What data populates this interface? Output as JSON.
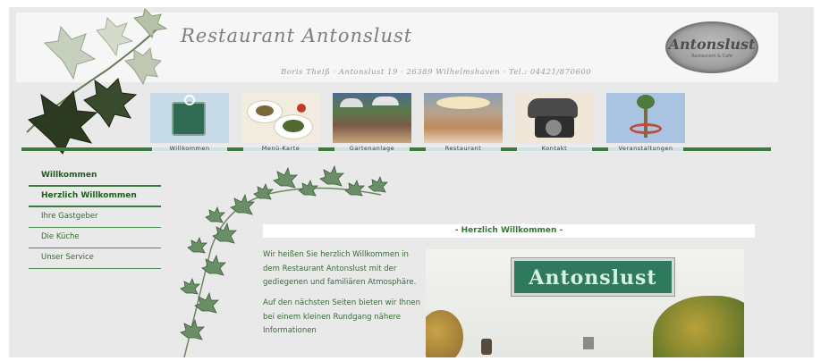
{
  "header": {
    "title": "Restaurant Antonslust",
    "address": "Boris Theiß · Antonslust 19 · 26389 Wilhelmshaven · Tel.: 04421/870600",
    "logo_text": "Antonslust",
    "logo_sub": "Restaurant & Café"
  },
  "nav": {
    "items": [
      {
        "label": "Willkommen"
      },
      {
        "label": "Menü-Karte"
      },
      {
        "label": "Gartenanlage"
      },
      {
        "label": "Restaurant"
      },
      {
        "label": "Kontakt"
      },
      {
        "label": "Veranstaltungen"
      }
    ],
    "accent": "#3c7a3c"
  },
  "sidebar": {
    "items": [
      {
        "label": "Willkommen"
      },
      {
        "label": "Herzlich Willkommen"
      },
      {
        "label": "Ihre Gastgeber"
      },
      {
        "label": "Die Küche"
      },
      {
        "label": "Unser Service"
      }
    ]
  },
  "content": {
    "title": "- Herzlich Willkommen -",
    "para1": "Wir heißen Sie herzlich Willkommen in dem Restaurant Antonslust mit der gediegenen und familiären Atmosphäre.",
    "para2": "Auf den nächsten Seiten bieten wir Ihnen bei einem kleinen Rundgang nähere Informationen",
    "photo_sign": "Antonslust"
  },
  "colors": {
    "background": "#e9e9e9",
    "link_green": "#2e6e2e",
    "title_green": "#2e7a2e"
  }
}
